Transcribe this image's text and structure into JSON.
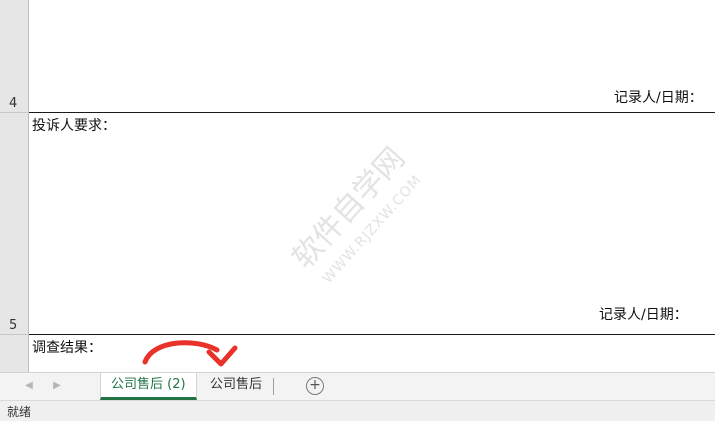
{
  "rows": [
    {
      "number": "4",
      "recorder_label": "记录人/日期："
    },
    {
      "number": "5",
      "title": "投诉人要求：",
      "recorder_label": "记录人/日期："
    },
    {
      "title": "调查结果："
    }
  ],
  "watermark": {
    "line1": "软件自学网",
    "line2": "WWW.RJZXW.COM"
  },
  "sheet_tabs": [
    {
      "label": "公司售后 (2)",
      "active": true
    },
    {
      "label": "公司售后",
      "active": false
    }
  ],
  "status": {
    "text": "就绪"
  },
  "colors": {
    "accent": "#217346",
    "annotation": "#e8322a"
  },
  "icons": {
    "prev": "chevron-left-icon",
    "next": "chevron-right-icon",
    "add": "plus-circle-icon"
  }
}
